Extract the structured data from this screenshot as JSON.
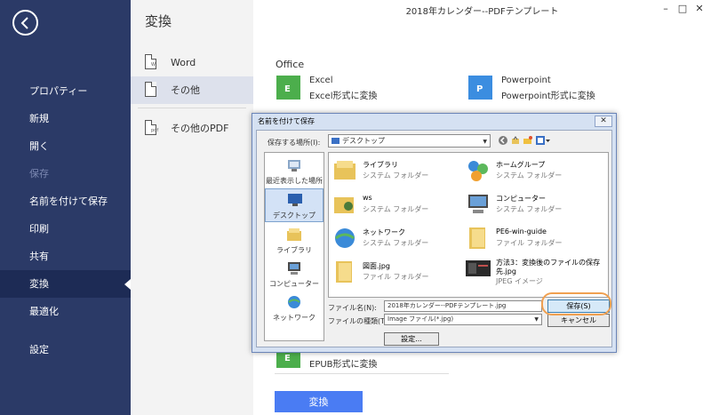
{
  "sidebar": {
    "items": [
      {
        "label": "プロパティー",
        "state": "normal"
      },
      {
        "label": "新規",
        "state": "normal"
      },
      {
        "label": "開く",
        "state": "normal"
      },
      {
        "label": "保存",
        "state": "disabled"
      },
      {
        "label": "名前を付けて保存",
        "state": "normal"
      },
      {
        "label": "印刷",
        "state": "normal"
      },
      {
        "label": "共有",
        "state": "normal"
      },
      {
        "label": "変換",
        "state": "active"
      },
      {
        "label": "最適化",
        "state": "normal"
      },
      {
        "label": "設定",
        "state": "normal"
      }
    ]
  },
  "panel": {
    "title": "変換",
    "items": [
      {
        "label": "Word",
        "icon_tag": "W"
      },
      {
        "label": "その他",
        "icon_tag": ""
      },
      {
        "label": "その他のPDF",
        "icon_tag": "pdf"
      }
    ]
  },
  "window": {
    "title": "2018年カレンダー--PDFテンプレート",
    "minimize": "–",
    "maximize": "□",
    "close": "✕"
  },
  "main": {
    "section_label": "Office",
    "formats": [
      {
        "name": "Excel",
        "desc": "Excel形式に変換",
        "letter": "E",
        "color": "#4cae4c"
      },
      {
        "name": "Powerpoint",
        "desc": "Powerpoint形式に変換",
        "letter": "P",
        "color": "#3b8de0"
      },
      {
        "name": "",
        "desc": "EPUB形式に変換",
        "letter": "E",
        "color": "#4cae4c"
      }
    ],
    "convert_button": "変換"
  },
  "dialog": {
    "title": "名前を付けて保存",
    "close": "✕",
    "save_in_label": "保存する場所(I):",
    "save_in_value": "デスクトップ",
    "places": [
      {
        "label": "最近表示した場所"
      },
      {
        "label": "デスクトップ"
      },
      {
        "label": "ライブラリ"
      },
      {
        "label": "コンピューター"
      },
      {
        "label": "ネットワーク"
      }
    ],
    "files": [
      {
        "name": "ライブラリ",
        "type": "システム フォルダー"
      },
      {
        "name": "ホームグループ",
        "type": "システム フォルダー"
      },
      {
        "name": "ws",
        "type": "システム フォルダー"
      },
      {
        "name": "コンピューター",
        "type": "システム フォルダー"
      },
      {
        "name": "ネットワーク",
        "type": "システム フォルダー"
      },
      {
        "name": "PE6-win-guide",
        "type": "ファイル フォルダー"
      },
      {
        "name": "図面.jpg",
        "type": "ファイル フォルダー"
      },
      {
        "name": "方法3：変換後のファイルの保存",
        "name2": "先.jpg",
        "type": "JPEG イメージ"
      }
    ],
    "filename_label": "ファイル名(N):",
    "filename_value": "2018年カレンダー--PDFテンプレート.jpg",
    "filetype_label": "ファイルの種類(T):",
    "filetype_value": "Image ファイル(*.jpg)",
    "save_button": "保存(S)",
    "cancel_button": "キャンセル",
    "settings_button": "設定..."
  }
}
